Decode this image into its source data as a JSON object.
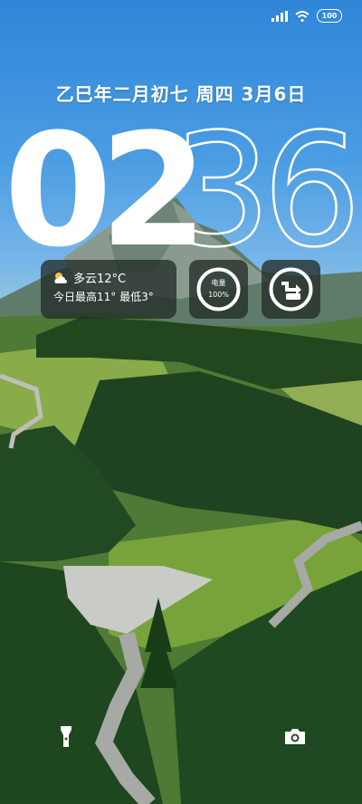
{
  "status_bar": {
    "battery_level": "100",
    "signal_icon": "signal-bars-icon",
    "wifi_icon": "wifi-icon"
  },
  "lockscreen": {
    "date_text": "乙巳年二月初七 周四 3月6日",
    "time_hour": "02",
    "time_minute": "36"
  },
  "widgets": {
    "weather": {
      "icon": "partly-cloudy-icon",
      "line1": "多云12°C",
      "line2": "今日最高11° 最低3°"
    },
    "battery": {
      "label": "电量",
      "value": "100%",
      "level": 1.0
    },
    "shortcut": {
      "icon": "app-switch-icon"
    }
  },
  "bottom": {
    "left_icon": "flashlight-icon",
    "right_icon": "camera-icon"
  },
  "colors": {
    "clock_fill": "#ffffff",
    "widget_bg": "#232d28",
    "sky": "#2f86d8",
    "forest": "#234a20"
  }
}
